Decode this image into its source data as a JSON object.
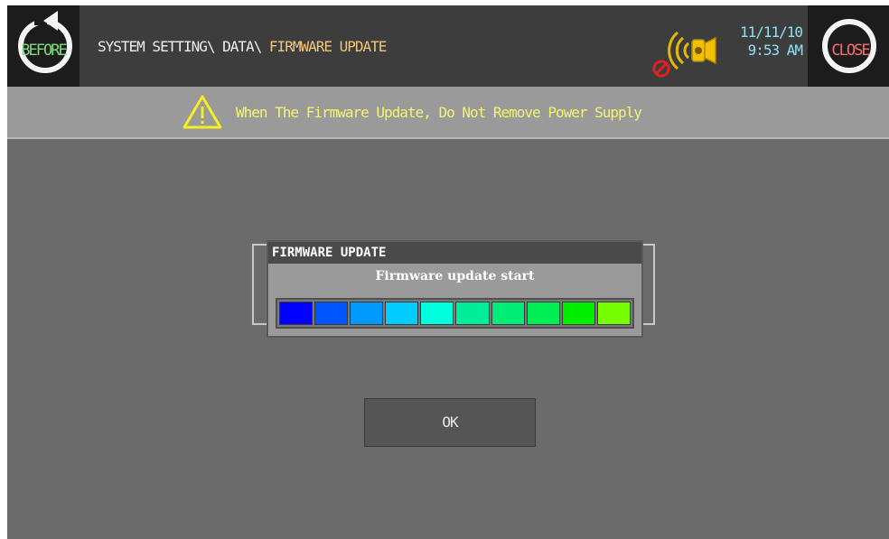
{
  "header": {
    "before_label": "BEFORE",
    "close_label": "CLOSE",
    "breadcrumb_path": "SYSTEM SETTING\\ DATA\\ ",
    "breadcrumb_current": "FIRMWARE UPDATE",
    "date": "11/11/10",
    "time": "9:53 AM"
  },
  "warning": {
    "text": "When The Firmware Update, Do Not Remove Power Supply"
  },
  "dialog": {
    "title": "FIRMWARE UPDATE",
    "message": "Firmware update start",
    "segments": [
      "#0000ff",
      "#0055ff",
      "#0099ff",
      "#00ccff",
      "#00ffdd",
      "#00ee99",
      "#00ee77",
      "#00ee55",
      "#00ee00",
      "#77ff00"
    ]
  },
  "ok_label": "OK",
  "colors": {
    "accent_current": "#f3c57a",
    "warning_text": "#f4f470",
    "clock": "#8fe0f0"
  }
}
